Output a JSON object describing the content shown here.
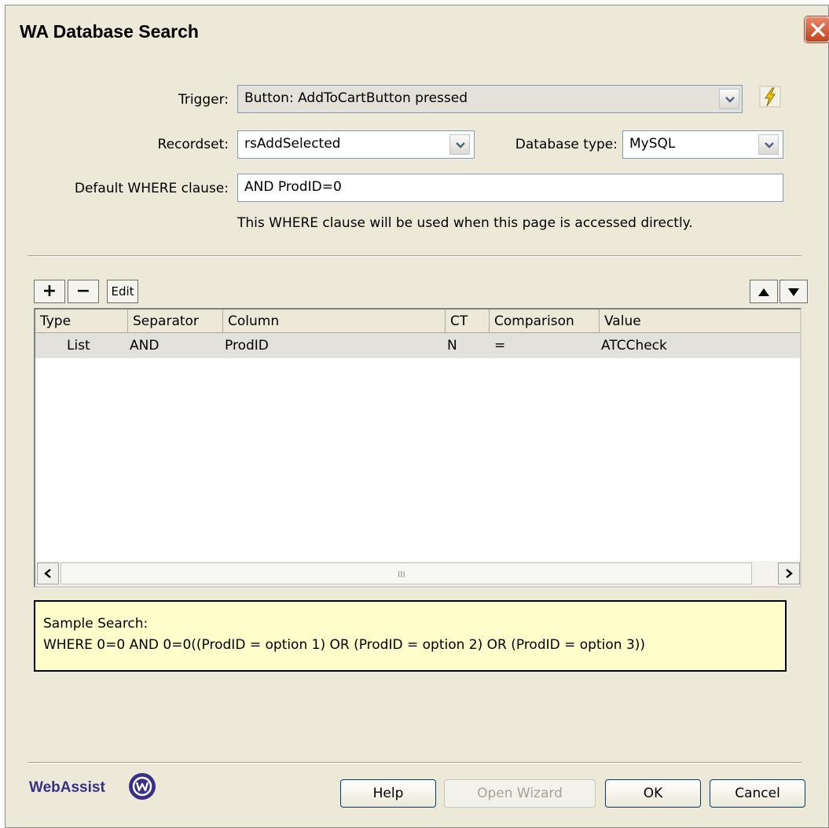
{
  "window": {
    "title": "WA Database Search"
  },
  "form": {
    "trigger_label": "Trigger:",
    "trigger_value": "Button: AddToCartButton pressed",
    "recordset_label": "Recordset:",
    "recordset_value": "rsAddSelected",
    "dbtype_label": "Database type:",
    "dbtype_value": "MySQL",
    "where_label": "Default WHERE clause:",
    "where_value": "AND ProdID=0",
    "where_note": "This WHERE clause will be used when this page is accessed directly."
  },
  "toolbar": {
    "add_label": "+",
    "remove_label": "−",
    "edit_label": "Edit"
  },
  "grid": {
    "columns": [
      "Type",
      "Separator",
      "Column",
      "CT",
      "Comparison",
      "Value"
    ],
    "rows": [
      {
        "type": "List",
        "separator": "AND",
        "column": "ProdID",
        "ct": "N",
        "comparison": "=",
        "value": "ATCCheck"
      }
    ],
    "scroll_grip": "III"
  },
  "sample": {
    "label": "Sample Search:",
    "text": "WHERE 0=0 AND 0=0((ProdID = option 1) OR (ProdID = option 2) OR (ProdID = option 3))"
  },
  "footer": {
    "logo_text": "WebAssist",
    "help_label": "Help",
    "wizard_label": "Open Wizard",
    "ok_label": "OK",
    "cancel_label": "Cancel"
  },
  "icons": {
    "close": "close-icon",
    "dropdown": "chevron-down-icon",
    "lightning": "lightning-icon",
    "move_up": "triangle-up-icon",
    "move_down": "triangle-down-icon",
    "scroll_left": "chevron-left-icon",
    "scroll_right": "chevron-right-icon"
  },
  "colors": {
    "dialog_bg": "#ece9d8",
    "sample_bg": "#ffffcc",
    "close_button": "#c2431f",
    "logo": "#3a2f86"
  }
}
